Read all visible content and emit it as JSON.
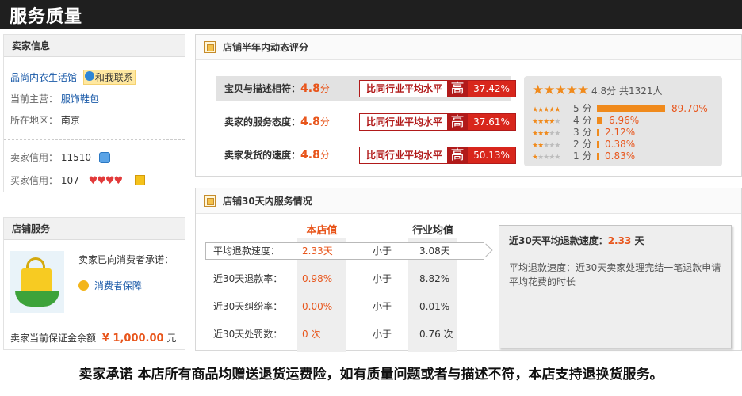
{
  "page_title": "服务质量",
  "seller_info": {
    "header": "卖家信息",
    "shop_name": "品尚内衣生活馆",
    "contact_label": "和我联系",
    "main_business_label": "当前主营：",
    "main_business_value": "服饰鞋包",
    "location_label": "所在地区：",
    "location_value": "南京",
    "seller_credit_label": "卖家信用：",
    "seller_credit_value": "11510",
    "buyer_credit_label": "买家信用：",
    "buyer_credit_value": "107"
  },
  "shop_service": {
    "header": "店铺服务",
    "promise_text": "卖家已向消费者承诺：",
    "guarantee_label": "消费者保障",
    "deposit_label": "卖家当前保证金余额",
    "deposit_value": "¥ 1,000.00",
    "deposit_unit": "元"
  },
  "dsr": {
    "header": "店铺半年内动态评分",
    "rows": [
      {
        "label": "宝贝与描述相符：",
        "score": "4.8",
        "unit": "分",
        "compare": "比同行业平均水平",
        "level": "高",
        "percent": "37.42%"
      },
      {
        "label": "卖家的服务态度：",
        "score": "4.8",
        "unit": "分",
        "compare": "比同行业平均水平",
        "level": "高",
        "percent": "37.61%"
      },
      {
        "label": "卖家发货的速度：",
        "score": "4.8",
        "unit": "分",
        "compare": "比同行业平均水平",
        "level": "高",
        "percent": "50.13%"
      }
    ],
    "summary_score": "4.8分",
    "summary_count": "共1321人",
    "distribution": [
      {
        "label": "5 分",
        "percent": "89.70%",
        "fraction": 0.897
      },
      {
        "label": "4 分",
        "percent": "6.96%",
        "fraction": 0.0696
      },
      {
        "label": "3 分",
        "percent": "2.12%",
        "fraction": 0.0212
      },
      {
        "label": "2 分",
        "percent": "0.38%",
        "fraction": 0.0038
      },
      {
        "label": "1 分",
        "percent": "0.83%",
        "fraction": 0.0083
      }
    ]
  },
  "service30": {
    "header": "店铺30天内服务情况",
    "col_shop": "本店值",
    "col_industry": "行业均值",
    "rows": [
      {
        "label": "平均退款速度：",
        "shop": "2.33天",
        "relation": "小于",
        "industry": "3.08天"
      },
      {
        "label": "近30天退款率：",
        "shop": "0.98%",
        "relation": "小于",
        "industry": "8.82%"
      },
      {
        "label": "近30天纠纷率：",
        "shop": "0.00%",
        "relation": "小于",
        "industry": "0.01%"
      },
      {
        "label": "近30天处罚数：",
        "shop": "0 次",
        "relation": "小于",
        "industry": "0.76 次"
      }
    ],
    "detail_title": "近30天平均退款速度：",
    "detail_value": "2.33",
    "detail_unit": "天",
    "detail_desc": "平均退款速度：近30天卖家处理完结一笔退款申请平均花费的时长"
  },
  "footer": "卖家承诺  本店所有商品均赠送退货运费险，如有质量问题或者与描述不符，本店支持退换货服务。",
  "colors": {
    "accent": "#e8551b",
    "compare_red": "#b11a1a",
    "bar": "#f08a1c",
    "link": "#1a5aa8"
  }
}
